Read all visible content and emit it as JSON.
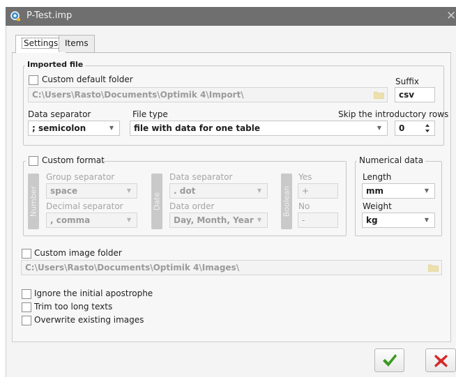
{
  "window": {
    "title": "P-Test.imp",
    "close_glyph": "✕"
  },
  "tabs": [
    {
      "label": "Settings",
      "active": true
    },
    {
      "label": "Items",
      "active": false
    }
  ],
  "imported_file": {
    "legend": "Imported file",
    "custom_default_folder_label": "Custom default folder",
    "custom_default_folder_checked": false,
    "folder_path": "C:\\Users\\Rasto\\Documents\\Optimik 4\\Import\\",
    "suffix_label": "Suffix",
    "suffix_value": "csv",
    "data_separator_label": "Data separator",
    "data_separator_value": "; semicolon",
    "file_type_label": "File type",
    "file_type_value": "file with data for one table",
    "skip_rows_label": "Skip the introductory rows",
    "skip_rows_value": "0"
  },
  "custom_format": {
    "legend": "Custom format",
    "checked": false,
    "number_tab": "Number",
    "group_separator_label": "Group separator",
    "group_separator_value": "space",
    "decimal_separator_label": "Decimal separator",
    "decimal_separator_value": ", comma",
    "date_tab": "Date",
    "date_separator_label": "Data separator",
    "date_separator_value": ". dot",
    "data_order_label": "Data order",
    "data_order_value": "Day, Month, Year",
    "boolean_tab": "Boolean",
    "yes_label": "Yes",
    "yes_value": "+",
    "no_label": "No",
    "no_value": "-"
  },
  "numerical_data": {
    "legend": "Numerical data",
    "length_label": "Length",
    "length_value": "mm",
    "weight_label": "Weight",
    "weight_value": "kg"
  },
  "image_folder": {
    "label": "Custom image folder",
    "checked": false,
    "path": "C:\\Users\\Rasto\\Documents\\Optimik 4\\Images\\"
  },
  "options": [
    {
      "label": "Ignore the initial apostrophe",
      "checked": false
    },
    {
      "label": "Trim too long texts",
      "checked": false
    },
    {
      "label": "Overwrite existing images",
      "checked": false
    }
  ],
  "buttons": {
    "ok_icon": "checkmark-icon",
    "cancel_icon": "cross-icon",
    "ok_color": "#3a9a1e",
    "cancel_color": "#d42a2a"
  },
  "colors": {
    "title_bar": "#6f6f6f",
    "folder_icon": "#e8d48a"
  }
}
